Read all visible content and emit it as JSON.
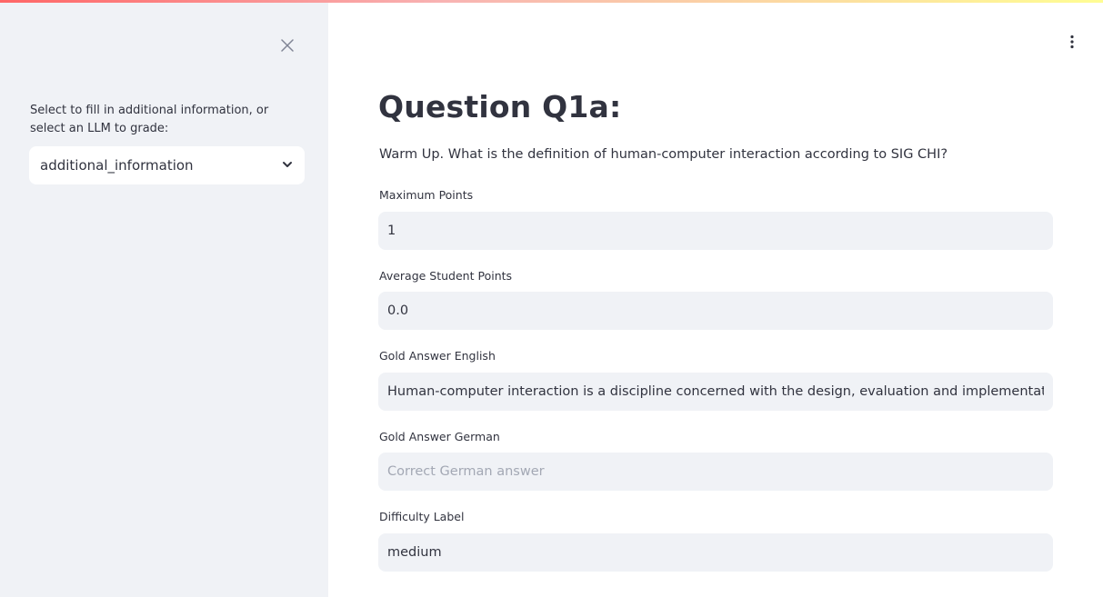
{
  "sidebar": {
    "select_label": "Select to fill in additional information, or select an LLM to grade:",
    "select_value": "additional_information"
  },
  "main": {
    "title": "Question Q1a:",
    "question": "Warm Up. What is the definition of human-computer interaction according to SIG CHI?",
    "fields": {
      "max_points": {
        "label": "Maximum Points",
        "value": "1"
      },
      "avg_points": {
        "label": "Average Student Points",
        "value": "0.0"
      },
      "gold_en": {
        "label": "Gold Answer English",
        "value": "Human-computer interaction is a discipline concerned with the design, evaluation and implementation"
      },
      "gold_de": {
        "label": "Gold Answer German",
        "value": "",
        "placeholder": "Correct German answer"
      },
      "difficulty": {
        "label": "Difficulty Label",
        "value": "medium"
      }
    }
  },
  "colors": {
    "sidebar_bg": "#f0f2f6",
    "input_bg": "#f0f2f6",
    "text": "#31333f",
    "placeholder": "#a3a8b4",
    "accent_gradient_start": "#ff4b4b",
    "accent_gradient_end": "#fffd80"
  },
  "icons": {
    "sidebar_close": "close-icon",
    "select_chevron": "chevron-down-icon",
    "main_menu": "kebab-menu-icon"
  }
}
